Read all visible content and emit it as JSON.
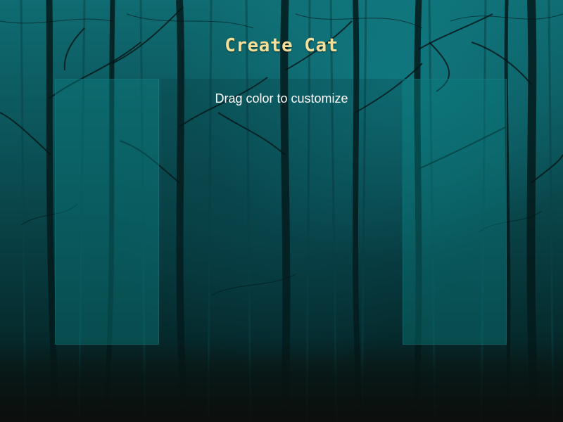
{
  "game": {
    "title": "Create Cat",
    "instruction": "Drag color to customize"
  },
  "background": {
    "scene": "misty teal forest",
    "colors": {
      "mist": "#0f6c72",
      "deep": "#062a2c",
      "ground": "#0a1a19",
      "title": "#f3df9a",
      "panel": "#0a787a"
    }
  },
  "panels": {
    "left": {
      "role": "color palette"
    },
    "center": {
      "role": "cat preview"
    },
    "right": {
      "role": "color palette"
    }
  }
}
